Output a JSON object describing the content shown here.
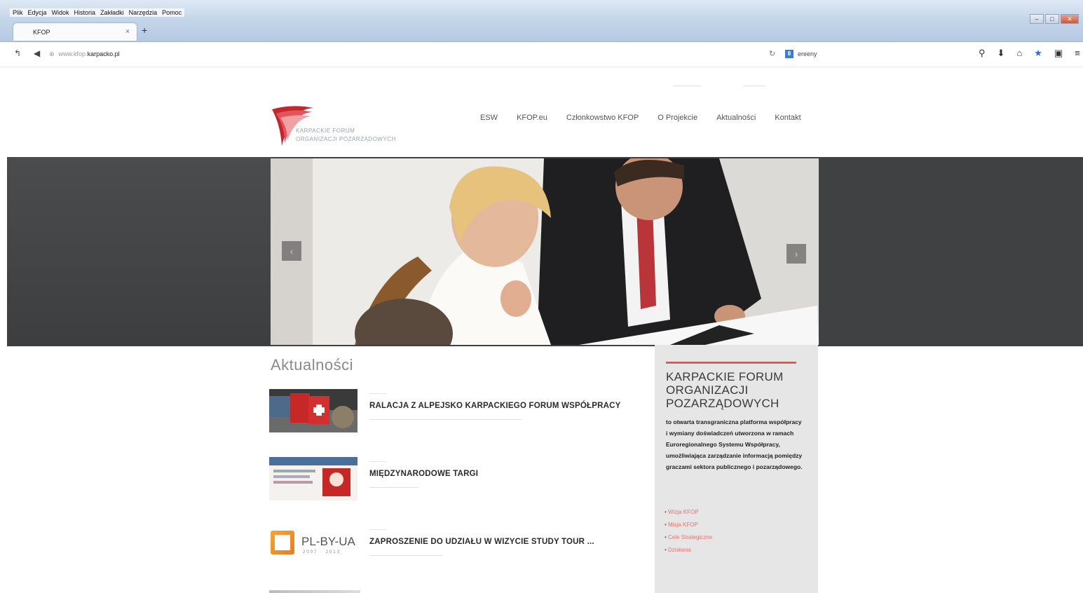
{
  "browser": {
    "menu": [
      "Plik",
      "Edycja",
      "Widok",
      "Historia",
      "Zakładki",
      "Narzędzia",
      "Pomoc"
    ],
    "tab_title": "KFOP",
    "tab_close": "×",
    "new_tab": "+",
    "url_prefix": "www.kfop.",
    "url": "karpacko.pl",
    "search_text": "ereeny",
    "search_logo": "8"
  },
  "site": {
    "topline": [
      "—————",
      "————"
    ],
    "logo_line1": "KARPACKIE FORUM",
    "logo_line2": "ORGANIZACJI POZARZĄDOWYCH",
    "nav": [
      "ESW",
      "KFOP.eu",
      "Członkowstwo KFOP",
      "O Projekcie",
      "Aktualności",
      "Kontakt"
    ],
    "colors": {
      "accent": "#d9534f",
      "dark_band": "#3f4142",
      "sidebar_bg": "#e6e6e6"
    }
  },
  "hero": {
    "prev_icon": "‹",
    "next_icon": "›"
  },
  "news": {
    "title": "Aktualności",
    "items": [
      {
        "title": "RALACJA Z ALPEJSKO KARPACKIEGO FORUM WSPÓŁPRACY",
        "date": "————",
        "excerpt": "———————————————————————————————"
      },
      {
        "title": "MIĘDZYNARODOWE TARGI",
        "date": "————",
        "excerpt": "——————————"
      },
      {
        "title": "ZAPROSZENIE DO UDZIAŁU W WIZYCIE STUDY TOUR ...",
        "date": "————",
        "excerpt": "———————————————",
        "thumb_text": "PL-BY-UA",
        "thumb_sub": "2007 · 2013"
      }
    ]
  },
  "sidebar": {
    "heading": "KARPACKIE FORUM ORGANIZACJI POZARZĄDOWYCH",
    "text": "to otwarta transgraniczna platforma współpracy i wymiany doświadczeń utworzona w ramach Euroregionalnego Systemu Współpracy, umożliwiająca zarządzanie informacją pomiędzy graczami sektora publicznego i pozarządowego.",
    "links": [
      "Wizja KFOP",
      "Misja KFOP",
      "Cele Strategiczne",
      "Działania"
    ]
  }
}
